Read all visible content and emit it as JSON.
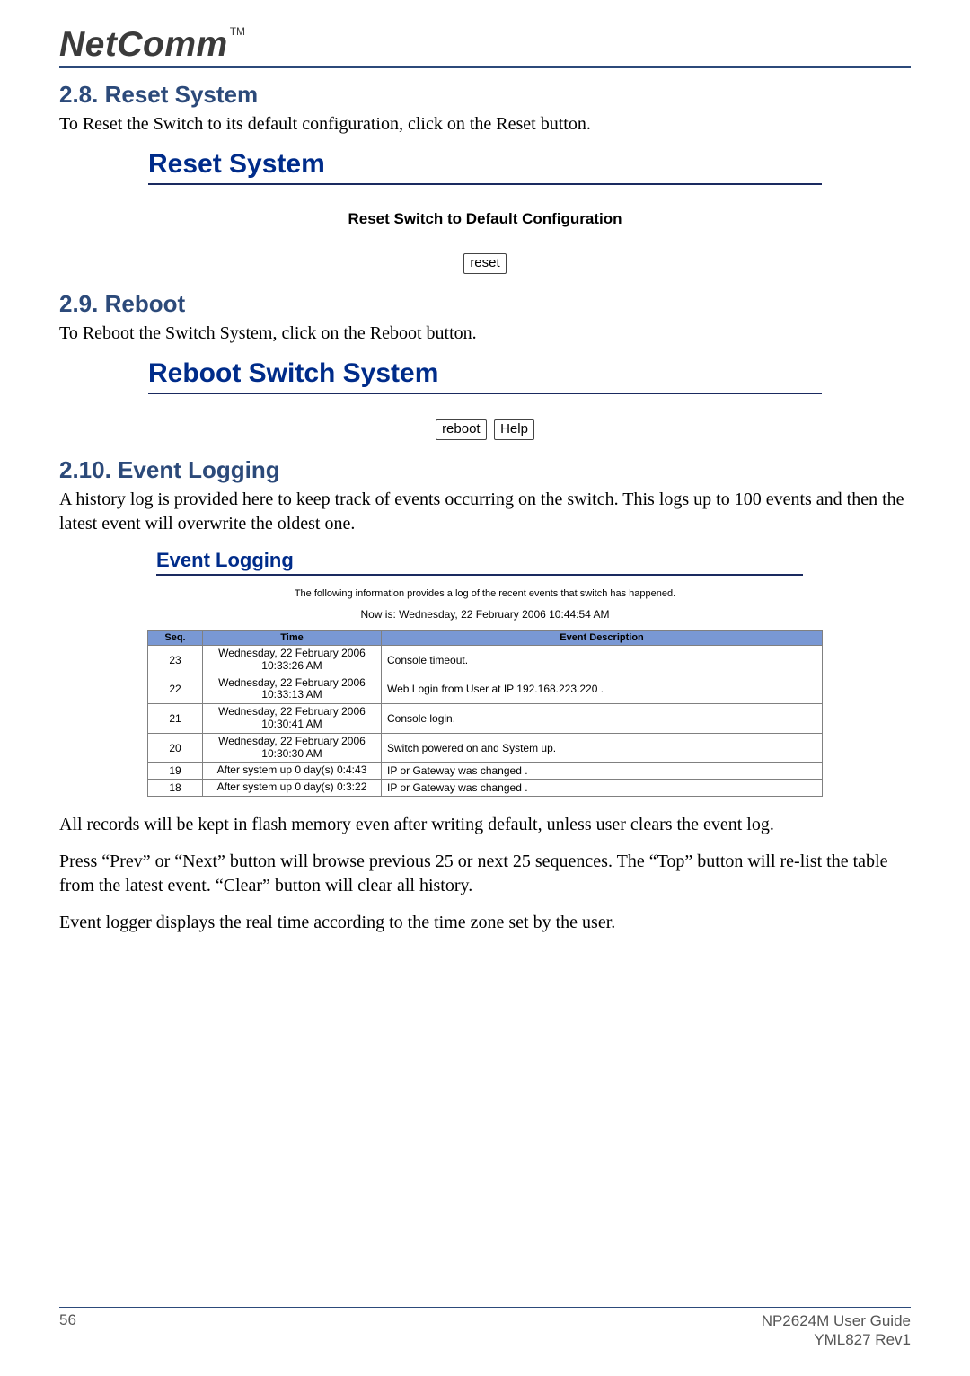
{
  "brand": {
    "name": "NetComm",
    "tm": "TM"
  },
  "sections": {
    "reset": {
      "heading": "2.8. Reset System",
      "body": "To Reset the Switch to its default configuration, click on the Reset button.",
      "panel_title": "Reset System",
      "panel_sub": "Reset Switch to Default Configuration",
      "btn_reset": "reset"
    },
    "reboot": {
      "heading": "2.9. Reboot",
      "body": "To Reboot the Switch System, click on the Reboot button.",
      "panel_title": "Reboot Switch System",
      "btn_reboot": "reboot",
      "btn_help": "Help"
    },
    "eventlog": {
      "heading": "2.10. Event Logging",
      "body_intro": "A history log is provided here to keep track of events occurring on the switch.  This logs up to 100 events and then the latest event will overwrite the oldest one.",
      "panel_title": "Event Logging",
      "caption": "The following information provides a log of the recent events that switch has happened.",
      "now": "Now is: Wednesday, 22 February 2006 10:44:54 AM",
      "cols": {
        "seq": "Seq.",
        "time": "Time",
        "desc": "Event Description"
      },
      "rows": [
        {
          "seq": "23",
          "time": "Wednesday, 22 February 2006 10:33:26 AM",
          "desc": "Console timeout."
        },
        {
          "seq": "22",
          "time": "Wednesday, 22 February 2006 10:33:13 AM",
          "desc": "Web Login from User at IP 192.168.223.220 ."
        },
        {
          "seq": "21",
          "time": "Wednesday, 22 February 2006 10:30:41 AM",
          "desc": "Console login."
        },
        {
          "seq": "20",
          "time": "Wednesday, 22 February 2006 10:30:30 AM",
          "desc": "Switch powered on and System up."
        },
        {
          "seq": "19",
          "time": "After system up 0 day(s) 0:4:43",
          "desc": "IP or Gateway was changed ."
        },
        {
          "seq": "18",
          "time": "After system up 0 day(s) 0:3:22",
          "desc": "IP or Gateway was changed ."
        }
      ],
      "body_after1": "All records will be kept in flash memory even after writing default, unless user clears the event log.",
      "body_after2": "Press “Prev” or “Next” button will browse previous 25 or next 25 sequences.  The “Top” button will re-list the table from the latest event.  “Clear” button will clear all history.",
      "body_after3": "Event logger displays the real time according to the time zone set by the user."
    }
  },
  "footer": {
    "page": "56",
    "doc": "NP2624M User Guide",
    "rev": "YML827 Rev1"
  }
}
